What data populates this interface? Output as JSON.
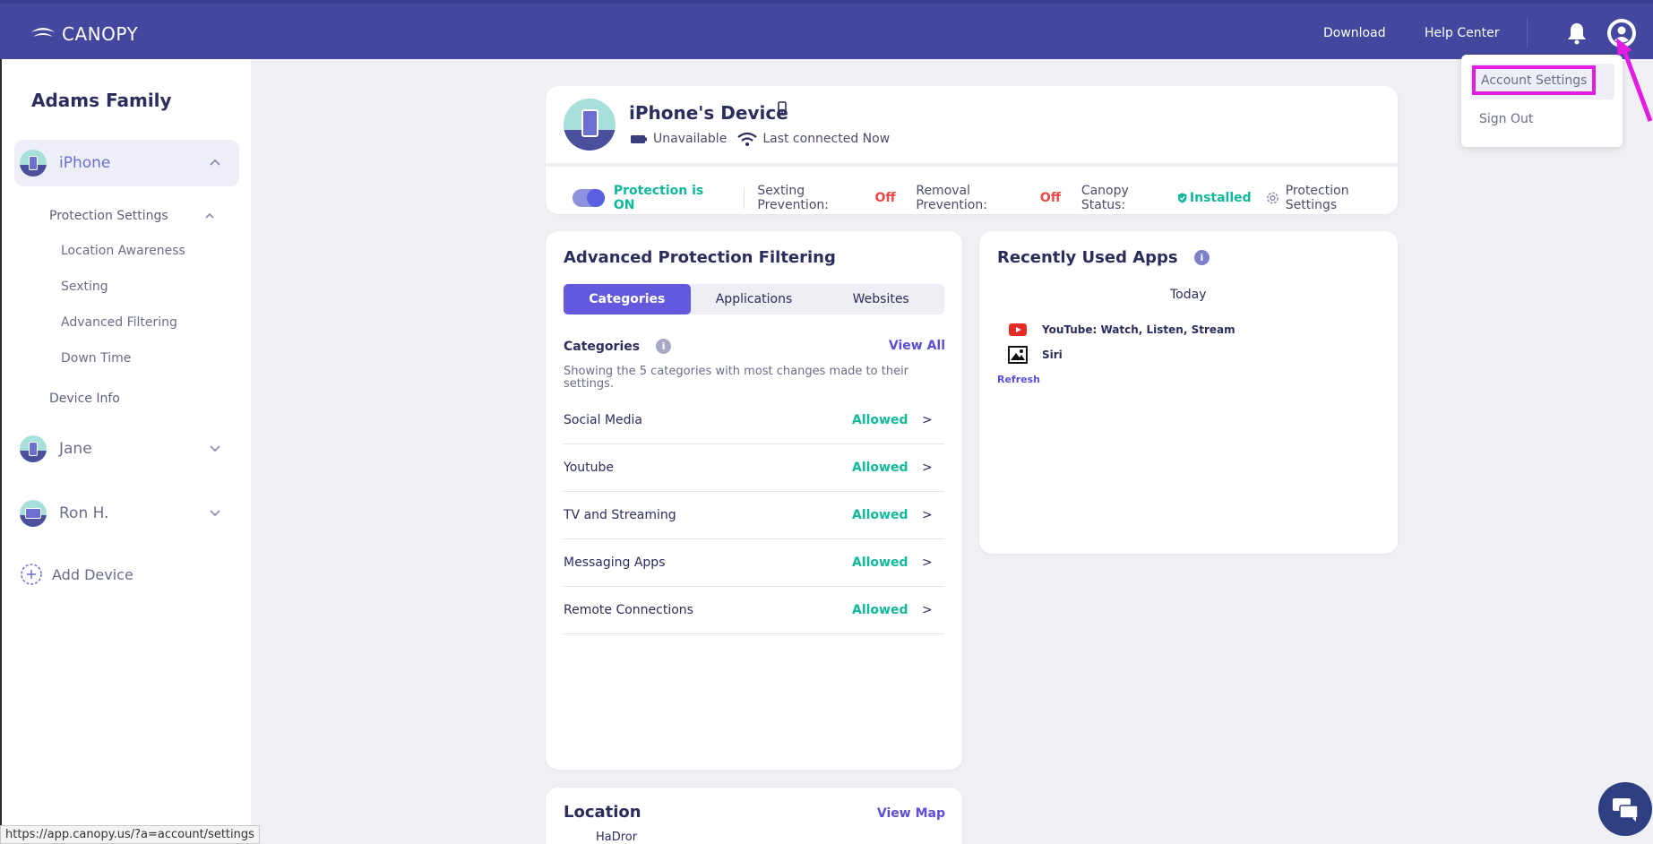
{
  "topbar": {
    "logo_text": "CANOPY",
    "download": "Download",
    "help_center": "Help Center"
  },
  "account_menu": {
    "account_settings": "Account Settings",
    "sign_out": "Sign Out"
  },
  "sidebar": {
    "family_name": "Adams Family",
    "devices": [
      {
        "name": "iPhone",
        "type": "phone",
        "expanded": true
      },
      {
        "name": "Jane",
        "type": "phone",
        "expanded": false
      },
      {
        "name": "Ron H.",
        "type": "computer",
        "expanded": false
      }
    ],
    "protection_settings": "Protection Settings",
    "sub_items": [
      "Location Awareness",
      "Sexting",
      "Advanced Filtering",
      "Down Time"
    ],
    "device_info": "Device Info",
    "add_device": "Add Device"
  },
  "device_card": {
    "title": "iPhone's Device",
    "battery_status": "Unavailable",
    "connection": "Last connected Now",
    "protection": "Protection is ON",
    "sexting_label": "Sexting Prevention:",
    "sexting_value": "Off",
    "removal_label": "Removal Prevention:",
    "removal_value": "Off",
    "canopy_status_label": "Canopy Status:",
    "canopy_status_value": "Installed",
    "protection_settings_link": "Protection Settings"
  },
  "filtering": {
    "title": "Advanced Protection Filtering",
    "tabs": [
      "Categories",
      "Applications",
      "Websites"
    ],
    "categories_heading": "Categories",
    "view_all": "View All",
    "description": "Showing the 5 categories with most changes made to their settings.",
    "rows": [
      {
        "name": "Social Media",
        "status": "Allowed"
      },
      {
        "name": "Youtube",
        "status": "Allowed"
      },
      {
        "name": "TV and Streaming",
        "status": "Allowed"
      },
      {
        "name": "Messaging Apps",
        "status": "Allowed"
      },
      {
        "name": "Remote Connections",
        "status": "Allowed"
      }
    ],
    "arrow": ">"
  },
  "recent_apps": {
    "title": "Recently Used Apps",
    "day": "Today",
    "apps": [
      "YouTube: Watch, Listen, Stream",
      "Siri"
    ],
    "refresh": "Refresh"
  },
  "location": {
    "title": "Location",
    "view_map": "View Map",
    "place": "HaDror"
  },
  "status_bar": {
    "url": "https://app.canopy.us/?a=account/settings"
  },
  "colors": {
    "topbar": "#43479e",
    "accent": "#6359dc",
    "green": "#0fb89a",
    "red": "#ea4a4a",
    "highlight": "#e31ce3"
  }
}
